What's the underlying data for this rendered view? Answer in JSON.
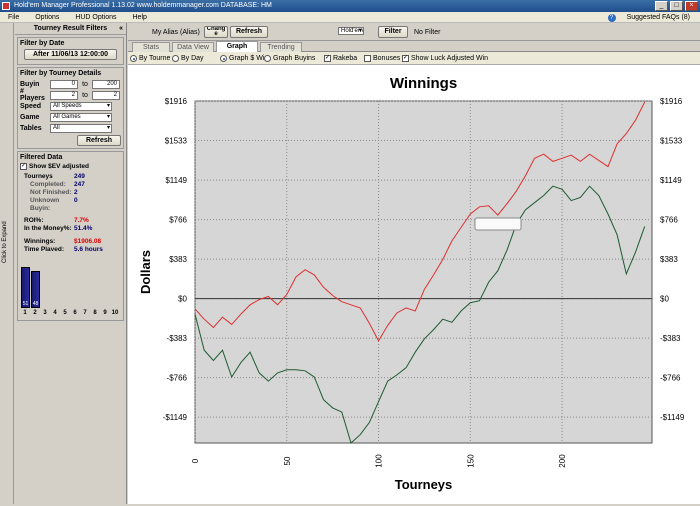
{
  "window": {
    "title": "Hold'em Manager Professional 1.13.02    www.holdemmanager.com    DATABASE: HM"
  },
  "menu": {
    "items": [
      "File",
      "Options",
      "HUD Options",
      "Help"
    ],
    "faq": "Suggested FAQs (8)"
  },
  "side_strip": {
    "label": "Click to Expand"
  },
  "left_panel": {
    "title": "Tourney Result Filters",
    "collapse": "«",
    "filter_date": {
      "title": "Filter by Date",
      "button": "After 11/06/13 12:00:00"
    },
    "filter_details": {
      "title": "Filter by Tourney Details",
      "buyin": {
        "label": "Buyin",
        "from": "0",
        "to_label": "to",
        "to": "200"
      },
      "players": {
        "label": "# Players",
        "from": "2",
        "to_label": "to",
        "to": "2"
      },
      "speed": {
        "label": "Speed",
        "value": "All Speeds"
      },
      "game": {
        "label": "Game",
        "value": "All Games"
      },
      "tables": {
        "label": "Tables",
        "value": "All"
      },
      "refresh": "Refresh"
    },
    "filtered": {
      "title": "Filtered Data",
      "ev_label": "Show $EV adjusted",
      "rows": [
        {
          "k": "Tourneys",
          "v": "249",
          "bold": true
        },
        {
          "k": "Completed:",
          "v": "247"
        },
        {
          "k": "Not Finished:",
          "v": "2"
        },
        {
          "k": "Unknown",
          "v": "0"
        },
        {
          "k": "Buyin:",
          "v": ""
        }
      ],
      "roi_label": "ROI%:",
      "roi": "7.7%",
      "itm_label": "In the Money%:",
      "itm": "51.4%",
      "winnings_label": "Winnings:",
      "winnings": "$1906.08",
      "time_label": "Time Played:",
      "time": "5.6 hours",
      "finish_bars": {
        "counts": [
          "51",
          "48"
        ],
        "positions": [
          "1",
          "2",
          "3",
          "4",
          "5",
          "6",
          "7",
          "8",
          "9",
          "10"
        ],
        "fill": [
          0.68,
          0.62
        ]
      }
    }
  },
  "topbar": {
    "alias_label": "My Alias (Alias)",
    "change_btn": "Chang e",
    "refresh_btn": "Refresh",
    "game_select": "Hold'em",
    "filter_btn": "Filter",
    "no_filter": "No Filter"
  },
  "tabs": [
    "Stats",
    "Data View",
    "Graph",
    "Trending"
  ],
  "options": {
    "by_tourney": "By Tourne",
    "by_day": "By Day",
    "graph_winnings": "Graph $ Wi",
    "graph_buyins": "Graph Buyins",
    "rakeback": "Rakeba",
    "bonuses": "Bonuses",
    "show_luck": "Show Luck Adjusted Win"
  },
  "colors": {
    "actual": "#e03030",
    "luck": "#1e5a32",
    "plot_bg": "#d6d6d6"
  },
  "chart_data": {
    "type": "line",
    "title": "Winnings",
    "xlabel": "Tourneys",
    "ylabel": "Dollars",
    "xlim": [
      0,
      249
    ],
    "ylim": [
      -1400,
      1916
    ],
    "xticks": [
      0,
      50,
      100,
      150,
      200
    ],
    "yticks": [
      1916,
      1533,
      1149,
      766,
      383,
      0,
      -383,
      -766,
      -1149
    ],
    "ytick_labels": [
      "$1916",
      "$1533",
      "$1149",
      "$766",
      "$383",
      "$0",
      "-$383",
      "-$766",
      "-$1149"
    ],
    "grid": true,
    "series": [
      {
        "points": [
          [
            0,
            -100
          ],
          [
            5,
            -200
          ],
          [
            10,
            -280
          ],
          [
            15,
            -180
          ],
          [
            20,
            -250
          ],
          [
            25,
            -150
          ],
          [
            30,
            -60
          ],
          [
            35,
            -10
          ],
          [
            40,
            20
          ],
          [
            45,
            -60
          ],
          [
            50,
            40
          ],
          [
            55,
            210
          ],
          [
            60,
            280
          ],
          [
            65,
            230
          ],
          [
            70,
            110
          ],
          [
            75,
            30
          ],
          [
            80,
            -30
          ],
          [
            85,
            -60
          ],
          [
            90,
            -90
          ],
          [
            95,
            -240
          ],
          [
            100,
            -410
          ],
          [
            105,
            -260
          ],
          [
            110,
            -140
          ],
          [
            115,
            -90
          ],
          [
            120,
            -120
          ],
          [
            125,
            90
          ],
          [
            130,
            230
          ],
          [
            135,
            380
          ],
          [
            140,
            560
          ],
          [
            145,
            690
          ],
          [
            150,
            820
          ],
          [
            155,
            890
          ],
          [
            160,
            900
          ],
          [
            165,
            810
          ],
          [
            170,
            920
          ],
          [
            175,
            1040
          ],
          [
            180,
            1190
          ],
          [
            185,
            1360
          ],
          [
            190,
            1400
          ],
          [
            195,
            1330
          ],
          [
            200,
            1360
          ],
          [
            205,
            1390
          ],
          [
            210,
            1330
          ],
          [
            215,
            1400
          ],
          [
            220,
            1340
          ],
          [
            225,
            1280
          ],
          [
            230,
            1500
          ],
          [
            235,
            1600
          ],
          [
            240,
            1730
          ],
          [
            245,
            1906
          ]
        ]
      },
      {
        "points": [
          [
            0,
            -150
          ],
          [
            5,
            -500
          ],
          [
            10,
            -600
          ],
          [
            15,
            -500
          ],
          [
            20,
            -760
          ],
          [
            25,
            -620
          ],
          [
            30,
            -520
          ],
          [
            35,
            -720
          ],
          [
            40,
            -800
          ],
          [
            45,
            -720
          ],
          [
            50,
            -690
          ],
          [
            55,
            -690
          ],
          [
            60,
            -700
          ],
          [
            65,
            -760
          ],
          [
            70,
            -980
          ],
          [
            75,
            -1060
          ],
          [
            80,
            -1100
          ],
          [
            85,
            -1400
          ],
          [
            90,
            -1320
          ],
          [
            95,
            -1200
          ],
          [
            100,
            -1000
          ],
          [
            105,
            -800
          ],
          [
            110,
            -740
          ],
          [
            115,
            -670
          ],
          [
            120,
            -520
          ],
          [
            125,
            -390
          ],
          [
            130,
            -300
          ],
          [
            135,
            -200
          ],
          [
            140,
            -230
          ],
          [
            145,
            -120
          ],
          [
            150,
            -40
          ],
          [
            155,
            -20
          ],
          [
            160,
            160
          ],
          [
            165,
            270
          ],
          [
            170,
            470
          ],
          [
            175,
            720
          ],
          [
            180,
            860
          ],
          [
            185,
            930
          ],
          [
            190,
            1000
          ],
          [
            195,
            1090
          ],
          [
            200,
            1060
          ],
          [
            205,
            950
          ],
          [
            210,
            980
          ],
          [
            215,
            1090
          ],
          [
            220,
            1000
          ],
          [
            225,
            820
          ],
          [
            230,
            620
          ],
          [
            235,
            240
          ],
          [
            240,
            450
          ],
          [
            245,
            700
          ]
        ]
      }
    ]
  }
}
